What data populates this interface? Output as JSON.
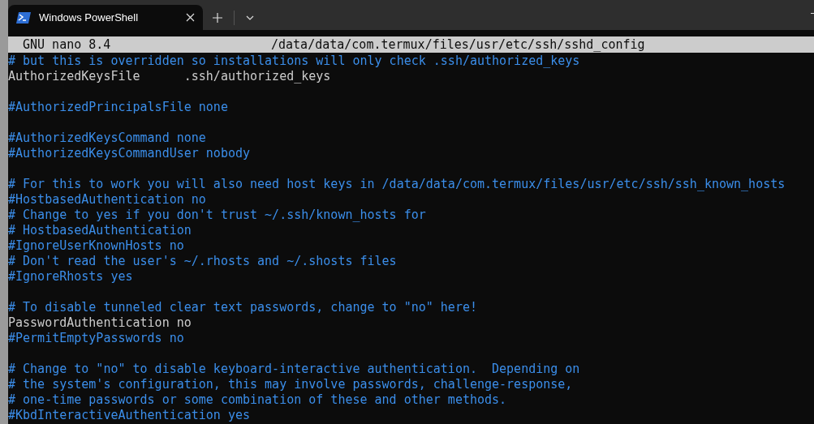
{
  "tab": {
    "title": "Windows PowerShell"
  },
  "nano_header": {
    "version": "GNU nano 8.4",
    "path": "/data/data/com.termux/files/usr/etc/ssh/sshd_config"
  },
  "lines": [
    {
      "kind": "comment",
      "text": "# but this is overridden so installations will only check .ssh/authorized_keys"
    },
    {
      "kind": "setting",
      "text": "AuthorizedKeysFile      .ssh/authorized_keys"
    },
    {
      "kind": "blank"
    },
    {
      "kind": "comment",
      "text": "#AuthorizedPrincipalsFile none"
    },
    {
      "kind": "blank"
    },
    {
      "kind": "comment",
      "text": "#AuthorizedKeysCommand none"
    },
    {
      "kind": "comment",
      "text": "#AuthorizedKeysCommandUser nobody"
    },
    {
      "kind": "blank"
    },
    {
      "kind": "comment",
      "text": "# For this to work you will also need host keys in /data/data/com.termux/files/usr/etc/ssh/ssh_known_hosts"
    },
    {
      "kind": "comment",
      "text": "#HostbasedAuthentication no"
    },
    {
      "kind": "comment",
      "text": "# Change to yes if you don't trust ~/.ssh/known_hosts for"
    },
    {
      "kind": "comment",
      "text": "# HostbasedAuthentication"
    },
    {
      "kind": "comment",
      "text": "#IgnoreUserKnownHosts no"
    },
    {
      "kind": "comment",
      "text": "# Don't read the user's ~/.rhosts and ~/.shosts files"
    },
    {
      "kind": "comment",
      "text": "#IgnoreRhosts yes"
    },
    {
      "kind": "blank"
    },
    {
      "kind": "comment",
      "text": "# To disable tunneled clear text passwords, change to \"no\" here!"
    },
    {
      "kind": "setting",
      "text": "PasswordAuthentication no"
    },
    {
      "kind": "comment",
      "text": "#PermitEmptyPasswords no"
    },
    {
      "kind": "blank"
    },
    {
      "kind": "comment",
      "text": "# Change to \"no\" to disable keyboard-interactive authentication.  Depending on"
    },
    {
      "kind": "comment",
      "text": "# the system's configuration, this may involve passwords, challenge-response,"
    },
    {
      "kind": "comment",
      "text": "# one-time passwords or some combination of these and other methods."
    },
    {
      "kind": "comment",
      "text": "#KbdInteractiveAuthentication yes"
    }
  ]
}
